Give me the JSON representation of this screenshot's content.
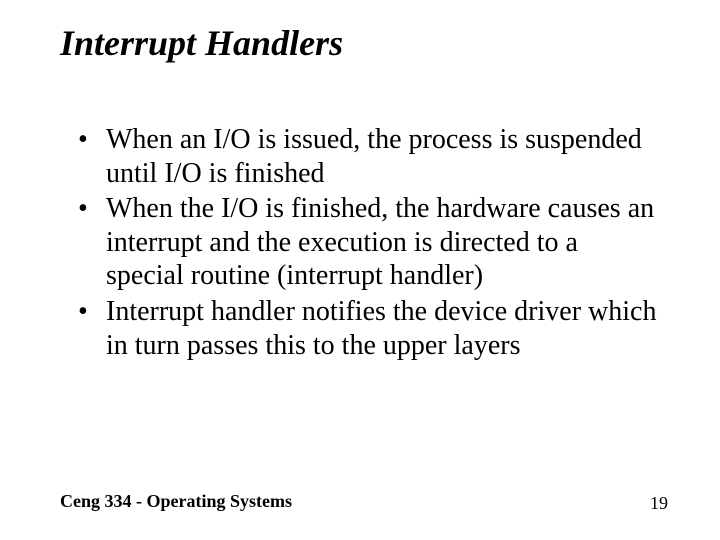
{
  "title": "Interrupt Handlers",
  "bullets": [
    "When an I/O is issued, the process is suspended until I/O is finished",
    "When the I/O is finished, the hardware causes an interrupt and the execution is directed to a special routine (interrupt handler)",
    "Interrupt handler notifies the device driver which in turn passes this to the upper layers"
  ],
  "footer": {
    "course": "Ceng 334 - Operating Systems",
    "page": "19"
  }
}
